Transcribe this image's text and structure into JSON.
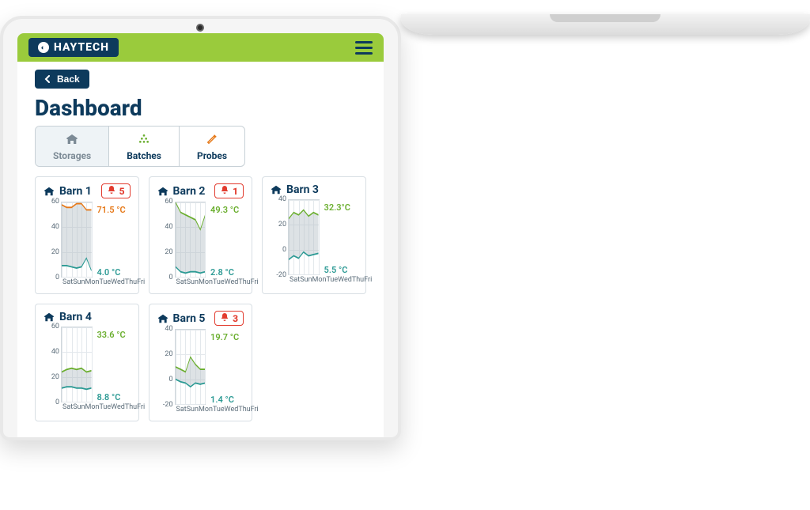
{
  "brand": "HAYTECH",
  "back_label": "Back",
  "page_title": "Dashboard",
  "tabs": [
    {
      "key": "storages",
      "label": "Storages",
      "icon": "barn",
      "active": true
    },
    {
      "key": "batches",
      "label": "Batches",
      "icon": "stack",
      "active": false
    },
    {
      "key": "probes",
      "label": "Probes",
      "icon": "probe",
      "active": false
    }
  ],
  "x_categories": [
    "Sat",
    "Sun",
    "Mon",
    "Tue",
    "Wed",
    "Thu",
    "Fri"
  ],
  "cards": [
    {
      "title": "Barn 1",
      "alert": 5,
      "high_label": "71.5 °C",
      "low_label": "4.0 °C",
      "high_color": "orange",
      "ymin": 0,
      "ymax": 60,
      "yticks": [
        0,
        20,
        40,
        60
      ]
    },
    {
      "title": "Barn 2",
      "alert": 1,
      "high_label": "49.3 °C",
      "low_label": "2.8 °C",
      "high_color": "green",
      "ymin": 0,
      "ymax": 60,
      "yticks": [
        0,
        20,
        40,
        60
      ]
    },
    {
      "title": "Barn 3",
      "alert": null,
      "high_label": "32.3°C",
      "low_label": "5.5 °C",
      "high_color": "green",
      "ymin": -20,
      "ymax": 40,
      "yticks": [
        -20,
        0,
        20,
        40
      ]
    },
    {
      "title": "Barn 4",
      "alert": null,
      "high_label": "33.6 °C",
      "low_label": "8.8 °C",
      "high_color": "green",
      "ymin": 0,
      "ymax": 60,
      "yticks": [
        0,
        20,
        40,
        60
      ]
    },
    {
      "title": "Barn 5",
      "alert": 3,
      "high_label": "19.7 °C",
      "low_label": "1.4 °C",
      "high_color": "green",
      "ymin": -20,
      "ymax": 40,
      "yticks": [
        -20,
        0,
        20,
        40
      ]
    }
  ],
  "chart_data": [
    {
      "name": "Barn 1",
      "type": "line",
      "categories": [
        "Sat",
        "Sun",
        "Mon",
        "Tue",
        "Wed",
        "Thu",
        "Fri"
      ],
      "series": [
        {
          "name": "high",
          "values": [
            58,
            56,
            56,
            59,
            59,
            54,
            54
          ]
        },
        {
          "name": "low",
          "values": [
            9,
            9,
            8,
            7,
            8,
            15,
            5
          ]
        }
      ],
      "title": "Barn 1",
      "xlabel": "",
      "ylabel": "°C",
      "ylim": [
        0,
        60
      ]
    },
    {
      "name": "Barn 2",
      "type": "line",
      "categories": [
        "Sat",
        "Sun",
        "Mon",
        "Tue",
        "Wed",
        "Thu",
        "Fri"
      ],
      "series": [
        {
          "name": "high",
          "values": [
            60,
            52,
            50,
            48,
            46,
            38,
            50
          ]
        },
        {
          "name": "low",
          "values": [
            8,
            4,
            3,
            4,
            4,
            3,
            4
          ]
        }
      ],
      "title": "Barn 2",
      "xlabel": "",
      "ylabel": "°C",
      "ylim": [
        0,
        60
      ]
    },
    {
      "name": "Barn 3",
      "type": "line",
      "categories": [
        "Sat",
        "Sun",
        "Mon",
        "Tue",
        "Wed",
        "Thu",
        "Fri"
      ],
      "series": [
        {
          "name": "high",
          "values": [
            25,
            30,
            28,
            32,
            27,
            30,
            28
          ]
        },
        {
          "name": "low",
          "values": [
            -8,
            -5,
            -7,
            -2,
            -5,
            -4,
            -3
          ]
        }
      ],
      "title": "Barn 3",
      "xlabel": "",
      "ylabel": "°C",
      "ylim": [
        -20,
        40
      ]
    },
    {
      "name": "Barn 4",
      "type": "line",
      "categories": [
        "Sat",
        "Sun",
        "Mon",
        "Tue",
        "Wed",
        "Thu",
        "Fri"
      ],
      "series": [
        {
          "name": "high",
          "values": [
            24,
            26,
            27,
            26,
            27,
            24,
            25
          ]
        },
        {
          "name": "low",
          "values": [
            11,
            12,
            12,
            11,
            11,
            10,
            11
          ]
        }
      ],
      "title": "Barn 4",
      "xlabel": "",
      "ylabel": "°C",
      "ylim": [
        0,
        60
      ]
    },
    {
      "name": "Barn 5",
      "type": "line",
      "categories": [
        "Sat",
        "Sun",
        "Mon",
        "Tue",
        "Wed",
        "Thu",
        "Fri"
      ],
      "series": [
        {
          "name": "high",
          "values": [
            10,
            8,
            6,
            18,
            12,
            8,
            8
          ]
        },
        {
          "name": "low",
          "values": [
            0,
            -2,
            -3,
            -6,
            -3,
            -4,
            -3
          ]
        }
      ],
      "title": "Barn 5",
      "xlabel": "",
      "ylabel": "°C",
      "ylim": [
        -20,
        40
      ]
    }
  ]
}
